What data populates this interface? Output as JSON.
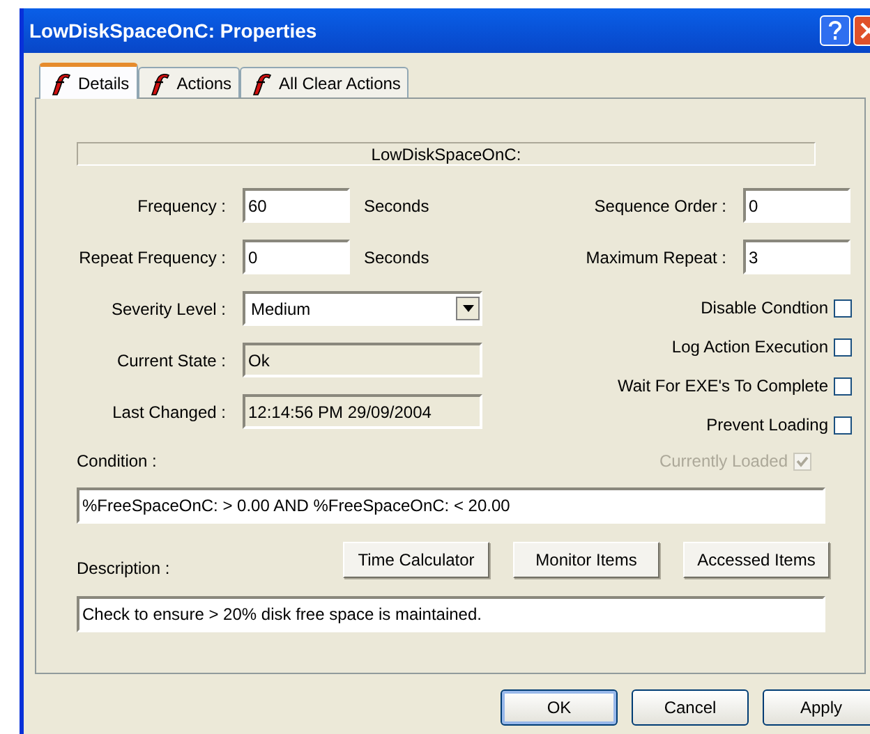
{
  "window": {
    "title": "LowDiskSpaceOnC: Properties"
  },
  "tabs": [
    {
      "label": "Details",
      "selected": true
    },
    {
      "label": "Actions",
      "selected": false
    },
    {
      "label": "All Clear Actions",
      "selected": false
    }
  ],
  "header": "LowDiskSpaceOnC:",
  "left_fields": [
    {
      "label": "Frequency :",
      "kind": "text",
      "value": "60",
      "unit": "Seconds"
    },
    {
      "label": "Repeat Frequency :",
      "kind": "text",
      "value": "0",
      "unit": "Seconds"
    },
    {
      "label": "Severity Level :",
      "kind": "dropdown",
      "value": "Medium"
    },
    {
      "label": "Current State :",
      "kind": "readonly",
      "value": "Ok"
    },
    {
      "label": "Last Changed :",
      "kind": "readonly",
      "value": "12:14:56 PM 29/09/2004"
    }
  ],
  "right_fields": [
    {
      "label": "Sequence Order :",
      "value": "0"
    },
    {
      "label": "Maximum Repeat  :",
      "value": "3"
    }
  ],
  "checkboxes": [
    {
      "label": "Disable Condtion",
      "checked": false,
      "disabled": false
    },
    {
      "label": "Log Action Execution",
      "checked": false,
      "disabled": false
    },
    {
      "label": "Wait For EXE's To Complete",
      "checked": false,
      "disabled": false
    },
    {
      "label": "Prevent Loading",
      "checked": false,
      "disabled": false
    },
    {
      "label": "Currently Loaded",
      "checked": true,
      "disabled": true
    }
  ],
  "condition": {
    "label": "Condition :",
    "value": "%FreeSpaceOnC: > 0.00 AND %FreeSpaceOnC: < 20.00"
  },
  "description": {
    "label": "Description :",
    "value": "Check to ensure > 20% disk free space is maintained."
  },
  "tool_buttons": [
    "Time Calculator",
    "Monitor Items",
    "Accessed Items"
  ],
  "dialog_buttons": [
    {
      "label": "OK",
      "default": true
    },
    {
      "label": "Cancel",
      "default": false
    },
    {
      "label": "Apply",
      "default": false
    }
  ]
}
